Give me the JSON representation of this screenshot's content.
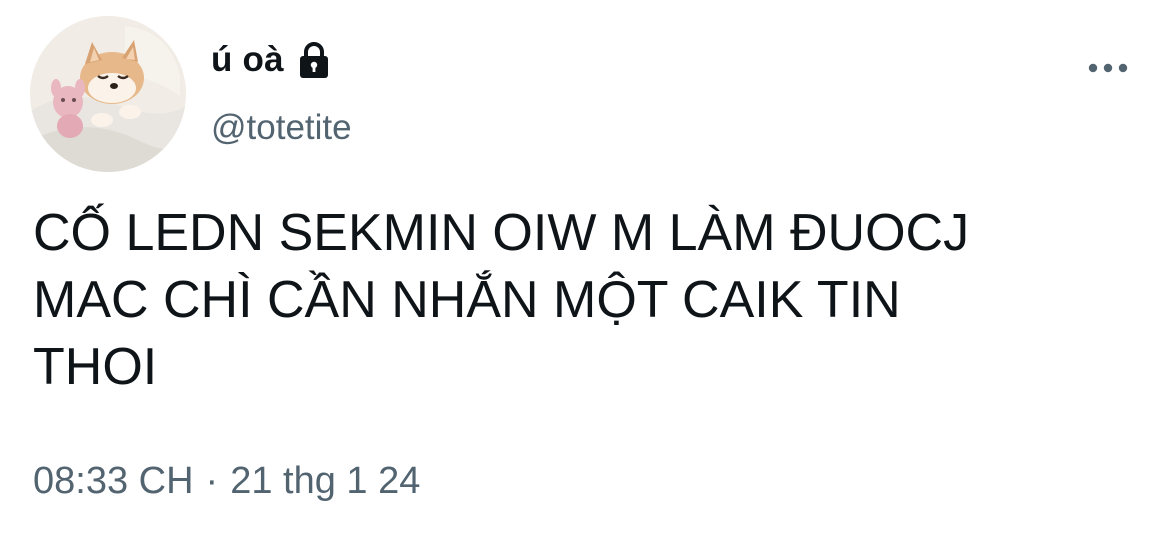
{
  "author": {
    "display_name": "ú oà",
    "handle": "@totetite",
    "avatar_icon": "shiba-dog-avatar",
    "lock_icon": "lock-icon"
  },
  "menu": {
    "icon": "more-horizontal-icon"
  },
  "tweet": {
    "text_lines": [
      "CỐ LEDN SEKMIN OIW M LÀM ĐUOCJ",
      "MAC CHÌ CẦN NHẮN MỘT CAIK TIN",
      "THOI"
    ],
    "time": "08:33 CH",
    "separator": "·",
    "date": "21 thg 1 24"
  },
  "colors": {
    "primary_text": "#0f1419",
    "secondary_text": "#536471",
    "background": "#ffffff"
  }
}
